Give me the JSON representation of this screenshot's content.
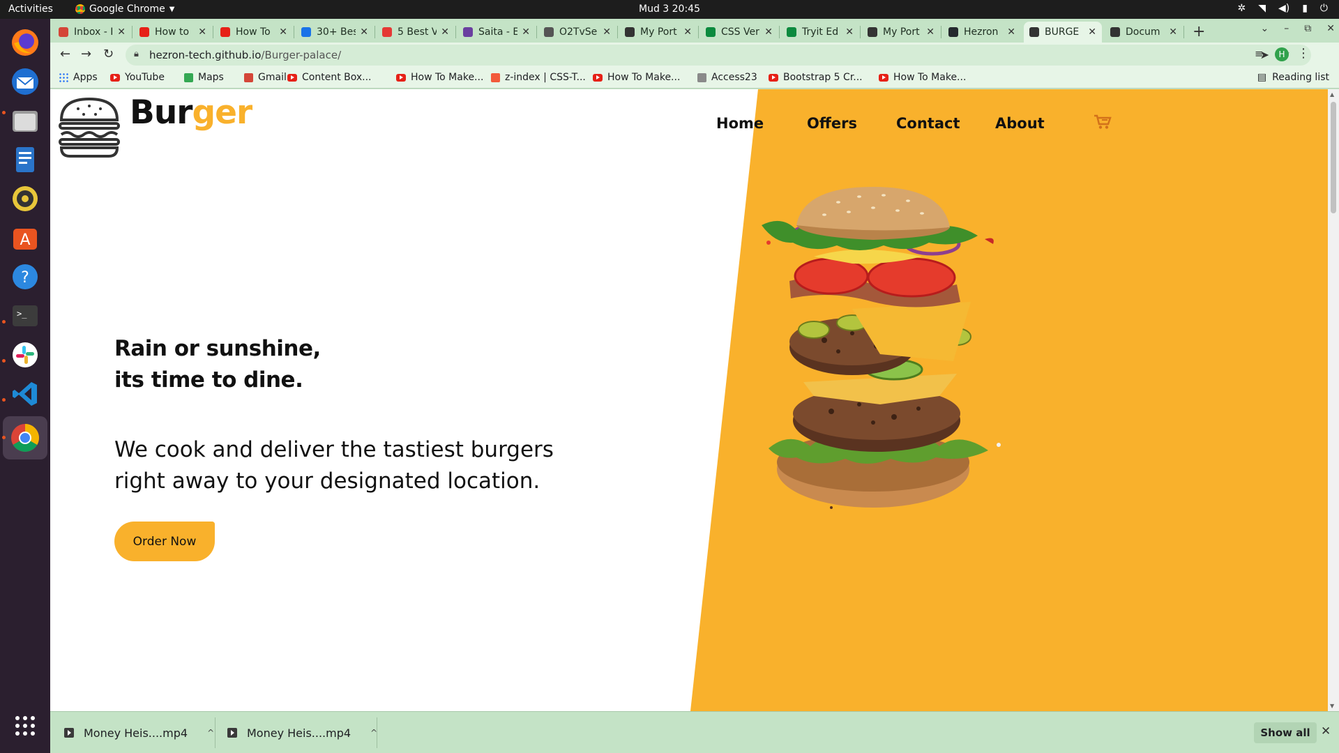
{
  "system": {
    "activities": "Activities",
    "app_name": "Google Chrome",
    "clock": "Mud 3  20:45"
  },
  "tabs": [
    {
      "title": "Inbox - I",
      "icon": "gmail-icon",
      "color": "#d44638"
    },
    {
      "title": "How to",
      "icon": "youtube-icon",
      "color": "#e62117"
    },
    {
      "title": "How To",
      "icon": "youtube-icon",
      "color": "#e62117"
    },
    {
      "title": "30+ Bes",
      "icon": "site-icon",
      "color": "#1a73e8"
    },
    {
      "title": "5 Best V",
      "icon": "s-icon",
      "color": "#e53935"
    },
    {
      "title": "Saita - E",
      "icon": "site-icon",
      "color": "#6a3fa0"
    },
    {
      "title": "O2TvSe",
      "icon": "site-icon",
      "color": "#555555"
    },
    {
      "title": "My Port",
      "icon": "globe-icon",
      "color": "#333333"
    },
    {
      "title": "CSS Ver",
      "icon": "w-icon",
      "color": "#0b8a3e"
    },
    {
      "title": "Tryit Ed",
      "icon": "w-icon",
      "color": "#0b8a3e"
    },
    {
      "title": "My Port",
      "icon": "globe-icon",
      "color": "#333333"
    },
    {
      "title": "Hezron",
      "icon": "github-icon",
      "color": "#24292e"
    },
    {
      "title": "BURGE",
      "icon": "globe-icon",
      "color": "#333333",
      "active": true
    },
    {
      "title": "Docum",
      "icon": "globe-icon",
      "color": "#333333"
    }
  ],
  "address_bar": {
    "host": "hezron-tech.github.io",
    "path": "/Burger-palace/"
  },
  "profile_initial": "H",
  "bookmarks": [
    {
      "label": "Apps",
      "icon": "apps-grid-icon"
    },
    {
      "label": "YouTube",
      "icon": "youtube-icon"
    },
    {
      "label": "Maps",
      "icon": "maps-icon"
    },
    {
      "label": "Gmail",
      "icon": "gmail-icon"
    },
    {
      "label": "Content Box...",
      "icon": "youtube-icon"
    },
    {
      "label": "How To Make...",
      "icon": "youtube-icon"
    },
    {
      "label": "z-index | CSS-T...",
      "icon": "css-tricks-icon"
    },
    {
      "label": "How To Make...",
      "icon": "youtube-icon"
    },
    {
      "label": "Access23",
      "icon": "site-icon"
    },
    {
      "label": "Bootstrap 5 Cr...",
      "icon": "youtube-icon"
    },
    {
      "label": "How To Make...",
      "icon": "youtube-icon"
    }
  ],
  "reading_list": "Reading list",
  "page": {
    "brand_a": "Bur",
    "brand_b": "ger",
    "nav": [
      "Home",
      "Offers",
      "Contact",
      "About"
    ],
    "headline_1": "Rain or sunshine,",
    "headline_2": "its time to dine.",
    "tagline_1": "We cook and deliver the tastiest burgers",
    "tagline_2": "right away to your designated location.",
    "cta": "Order Now",
    "accent_color": "#f9b12c"
  },
  "downloads": [
    {
      "name": "Money Heis....mp4"
    },
    {
      "name": "Money Heis....mp4"
    }
  ],
  "show_all": "Show all"
}
